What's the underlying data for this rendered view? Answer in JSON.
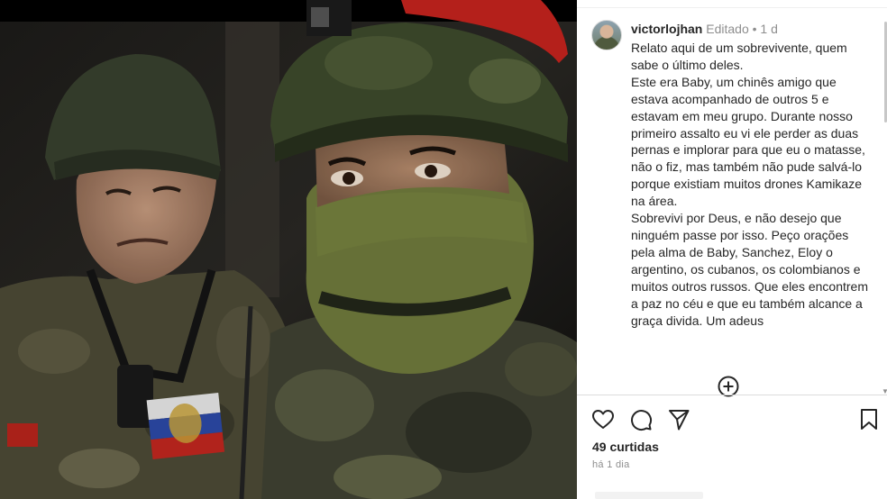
{
  "post": {
    "username": "victorlojhan",
    "edited_label": "Editado",
    "separator": "•",
    "age_short": "1 d",
    "caption": "Relato aqui de um sobrevivente, quem sabe o último deles.\nEste era Baby, um chinês amigo que estava acompanhado de outros 5 e estavam em meu grupo. Durante nosso primeiro assalto eu vi ele perder as duas pernas e implorar para que eu o matasse, não o fiz, mas também não pude salvá-lo porque existiam muitos drones Kamikaze na área.\nSobrevivi por Deus, e não desejo que ninguém passe por isso. Peço orações pela alma de Baby, Sanchez, Eloy o argentino, os cubanos, os colombianos e muitos outros russos. Que eles encontrem a paz no céu e que eu também alcance a graça divida. Um adeus",
    "likes": "49 curtidas",
    "posted": "há 1 dia"
  },
  "icons": {
    "avatar": "profile-avatar",
    "load_more": "plus-circle-icon",
    "like": "heart-icon",
    "comment": "comment-bubble-icon",
    "share": "paper-plane-icon",
    "save": "bookmark-icon"
  },
  "colors": {
    "text": "#262626",
    "muted": "#8e8e8e",
    "divider": "#dbdbdb"
  }
}
